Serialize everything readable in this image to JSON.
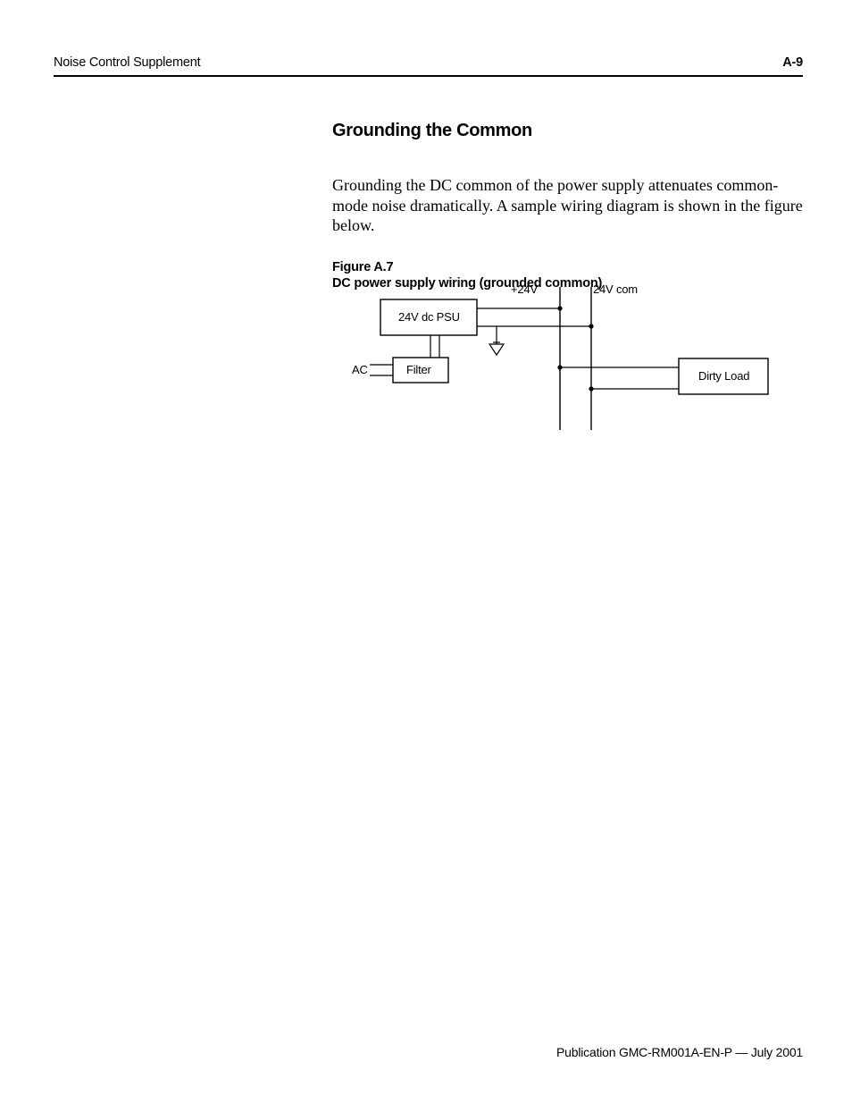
{
  "header": {
    "title": "Noise Control Supplement",
    "page_number": "A-9"
  },
  "section": {
    "heading": "Grounding the Common",
    "body": "Grounding the DC common of the power supply attenuates common-mode noise dramatically. A sample wiring diagram is shown in the figure below."
  },
  "figure": {
    "label_line1": "Figure A.7",
    "label_line2": "DC power supply wiring (grounded common)",
    "labels": {
      "plus24v": "+24V",
      "com24v": "24V com",
      "psu": "24V dc PSU",
      "ac": "AC",
      "filter": "Filter",
      "dirty_load": "Dirty Load"
    }
  },
  "footer": {
    "publication": "Publication GMC-RM001A-EN-P — July 2001"
  }
}
